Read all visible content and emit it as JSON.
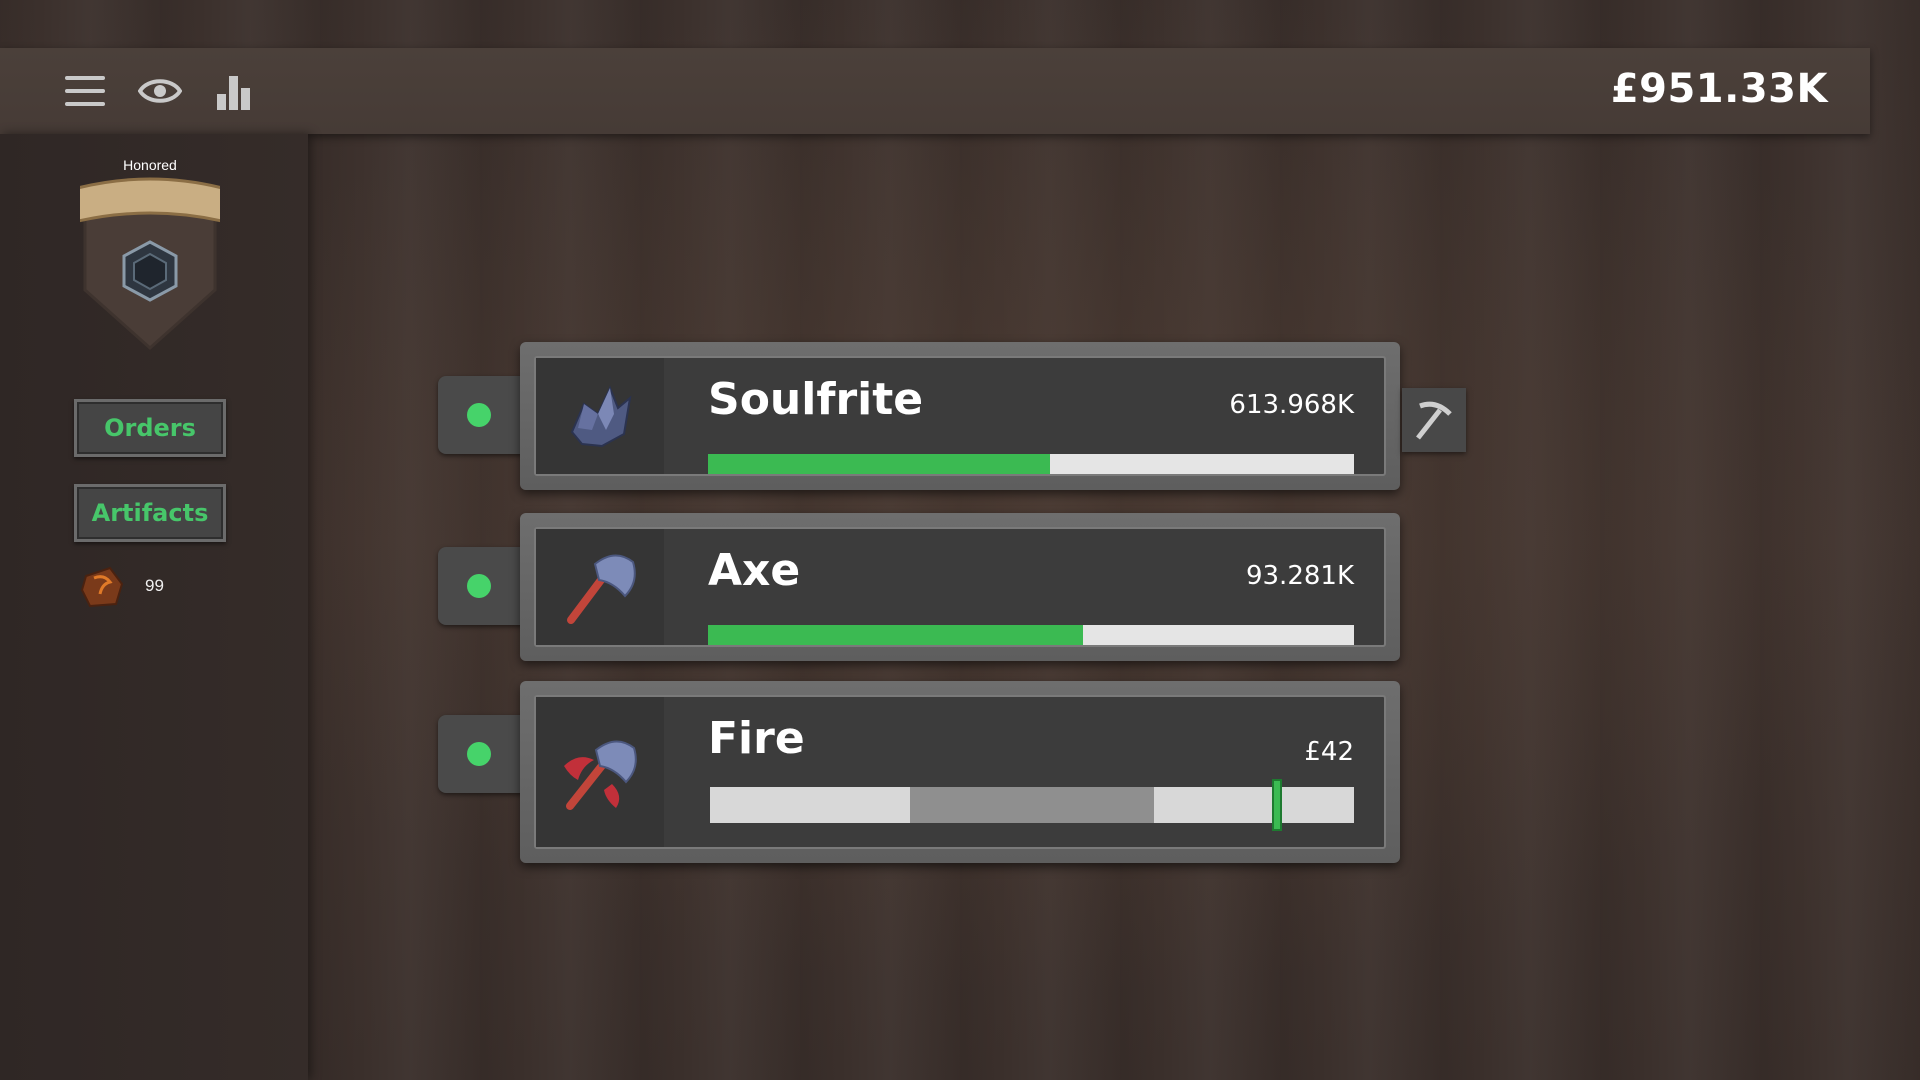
{
  "header": {
    "currency": "£951.33K",
    "icons": [
      "menu-icon",
      "eye-icon",
      "stats-icon"
    ]
  },
  "sidebar": {
    "rank": "Honored",
    "orders_label": "Orders",
    "artifacts_label": "Artifacts",
    "artifact_count": "99"
  },
  "rows": [
    {
      "name": "Soulfrite",
      "value": "613.968K",
      "progress": 0.53,
      "active": true,
      "icon": "soulfrite-ore-icon"
    },
    {
      "name": "Axe",
      "value": "93.281K",
      "progress": 0.58,
      "active": true,
      "icon": "axe-icon"
    },
    {
      "name": "Fire",
      "value": "£42",
      "timing_zone": [
        0.31,
        0.69
      ],
      "marker": 0.88,
      "active": true,
      "icon": "fire-axe-icon"
    }
  ],
  "colors": {
    "accent_green": "#3bba52",
    "dot_green": "#46d36a",
    "button_text_green": "#47c66a"
  }
}
